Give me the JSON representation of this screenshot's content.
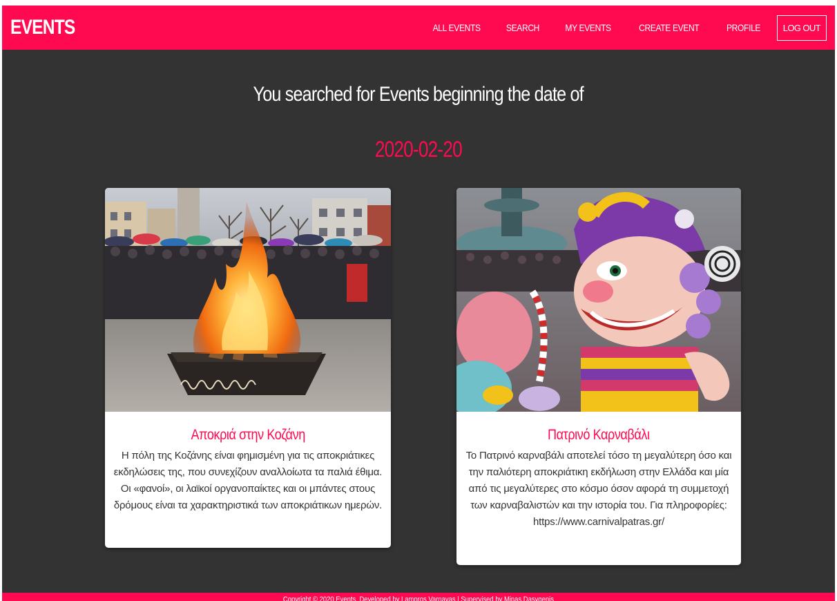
{
  "navbar": {
    "brand": "EVENTS",
    "links": [
      {
        "label": "ALL EVENTS"
      },
      {
        "label": "SEARCH"
      },
      {
        "label": "MY EVENTS"
      },
      {
        "label": "CREATE EVENT"
      },
      {
        "label": "PROFILE"
      },
      {
        "label": "LOG OUT"
      }
    ]
  },
  "search": {
    "heading": "You searched for Events beginning the date of",
    "date": "2020-02-20"
  },
  "events": [
    {
      "title": "Αποκριά στην Κοζάνη",
      "description": "Η πόλη της Κοζάνης είναι φημισμένη για τις αποκριάτικες εκδηλώσεις της, που συνεχίζουν αναλλοίωτα τα παλιά έθιμα. Οι «φανοί», οι λαϊκοί οργανοπαίκτες και οι μπάντες στους δρόμους είναι τα χαρακτηριστικά των αποκριάτικων ημερών."
    },
    {
      "title": "Πατρινό Καρναβάλι",
      "description": "Το Πατρινό καρναβάλι αποτελεί τόσο τη μεγαλύτερη όσο και την παλιότερη αποκριάτικη εκδήλωση στην Ελλάδα και μία από τις μεγαλύτερες στο κόσμο όσον αφορά τη συμμετοχή των καρναβαλιστών και την ιστορία του. Για πληροφορίες: https://www.carnivalpatras.gr/"
    }
  ],
  "footer": {
    "text": "Copyright © 2020 Events. Developed by Lampros Varnavas | Supervised by Minas Dasygenis"
  },
  "colors": {
    "accent": "#ff0a50",
    "background": "#333333",
    "card": "#ffffff"
  }
}
